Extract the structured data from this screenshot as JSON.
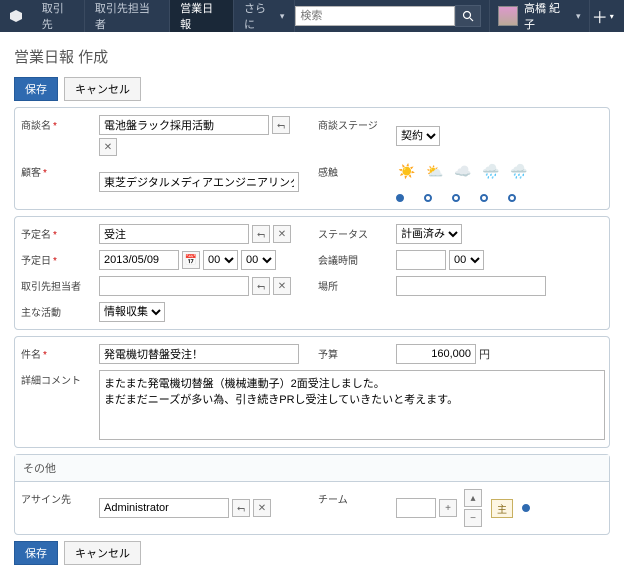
{
  "topbar": {
    "tabs": [
      "取引先",
      "取引先担当者",
      "営業日報",
      "さらに"
    ],
    "search_placeholder": "検索",
    "username": "高橋 紀子"
  },
  "page": {
    "title": "営業日報 作成"
  },
  "buttons": {
    "save": "保存",
    "cancel": "キャンセル"
  },
  "labels": {
    "negotiation_name": "商談名",
    "customer": "顧客",
    "stage": "商談ステージ",
    "feeling": "感触",
    "plan_name": "予定名",
    "plan_date": "予定日",
    "contact": "取引先担当者",
    "main_activity": "主な活動",
    "status": "ステータス",
    "meeting_time": "会議時間",
    "place": "場所",
    "subject": "件名",
    "detail_comment": "詳細コメント",
    "budget": "予算",
    "yen": "円",
    "other": "その他",
    "assign": "アサイン先",
    "team": "チーム",
    "main_badge": "主"
  },
  "values": {
    "negotiation_name": "電池盤ラック採用活動",
    "customer": "東芝デジタルメディアエンジニアリング",
    "stage": "契約",
    "plan_name": "受注",
    "plan_date": "2013/05/09",
    "hour": "00",
    "minute": "00",
    "main_activity": "情報収集",
    "status": "計画済み",
    "meeting_time": "",
    "meeting_hour": "00",
    "place": "",
    "subject": "発電機切替盤受注！",
    "comment": "またまた発電機切替盤（機械連動子）2面受注しました。\nまだまだニーズが多い為、引き続きPRし受注していきたいと考えます。",
    "budget": "160,000",
    "assign": "Administrator"
  }
}
